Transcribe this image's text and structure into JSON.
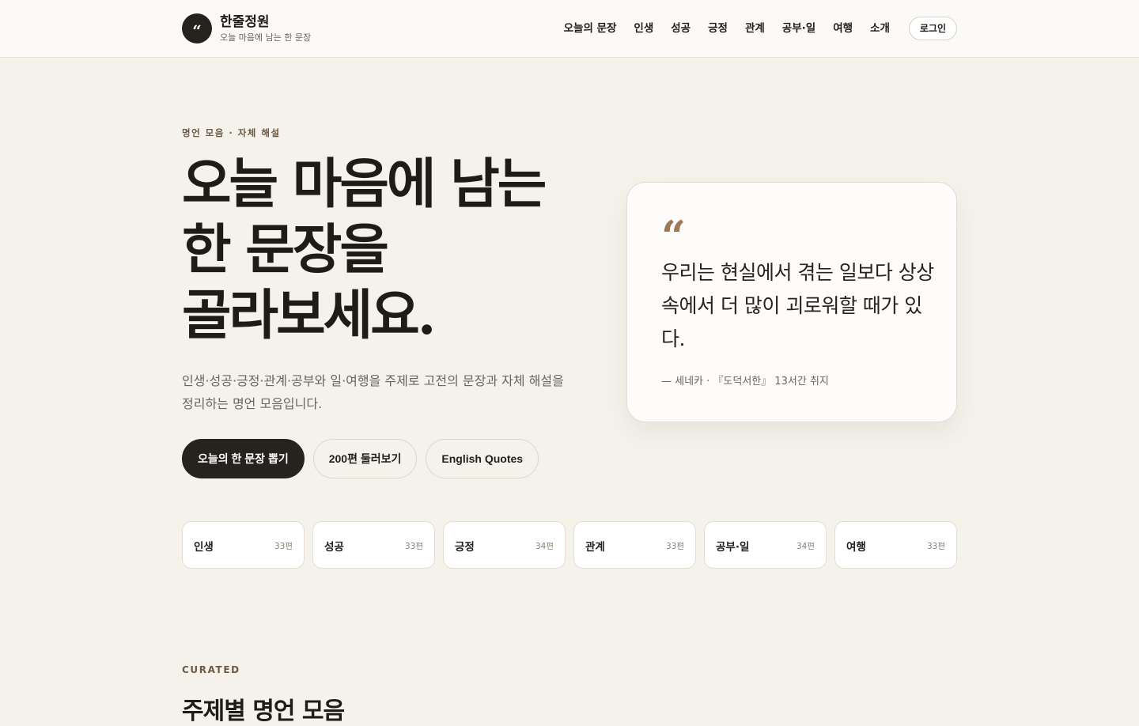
{
  "header": {
    "logo_mark": "“",
    "title": "한줄정원",
    "subtitle": "오늘 마음에 남는 한 문장",
    "nav": [
      "오늘의 문장",
      "인생",
      "성공",
      "긍정",
      "관계",
      "공부·일",
      "여행",
      "소개"
    ],
    "login_label": "로그인"
  },
  "hero": {
    "eyebrow": "명언 모음 · 자체 해설",
    "title_line1": "오늘 마음에 남는",
    "title_line2": "한 문장을",
    "title_line3": "골라보세요.",
    "description": "인생·성공·긍정·관계·공부와 일·여행을 주제로 고전의 문장과 자체 해설을 정리하는 명언 모음입니다.",
    "buttons": {
      "primary": "오늘의 한 문장 뽑기",
      "browse": "200편 둘러보기",
      "english": "English Quotes"
    }
  },
  "quote": {
    "mark": "“",
    "text": "우리는 현실에서 겪는 일보다 상상 속에서 더 많이 괴로워할 때가 있다.",
    "source": "— 세네카 · 『도덕서한』 13서간 취지"
  },
  "categories": [
    {
      "name": "인생",
      "count": "33편"
    },
    {
      "name": "성공",
      "count": "33편"
    },
    {
      "name": "긍정",
      "count": "34편"
    },
    {
      "name": "관계",
      "count": "33편"
    },
    {
      "name": "공부·일",
      "count": "34편"
    },
    {
      "name": "여행",
      "count": "33편"
    }
  ],
  "section": {
    "eyebrow": "CURATED",
    "title": "주제별 명언 모음"
  }
}
